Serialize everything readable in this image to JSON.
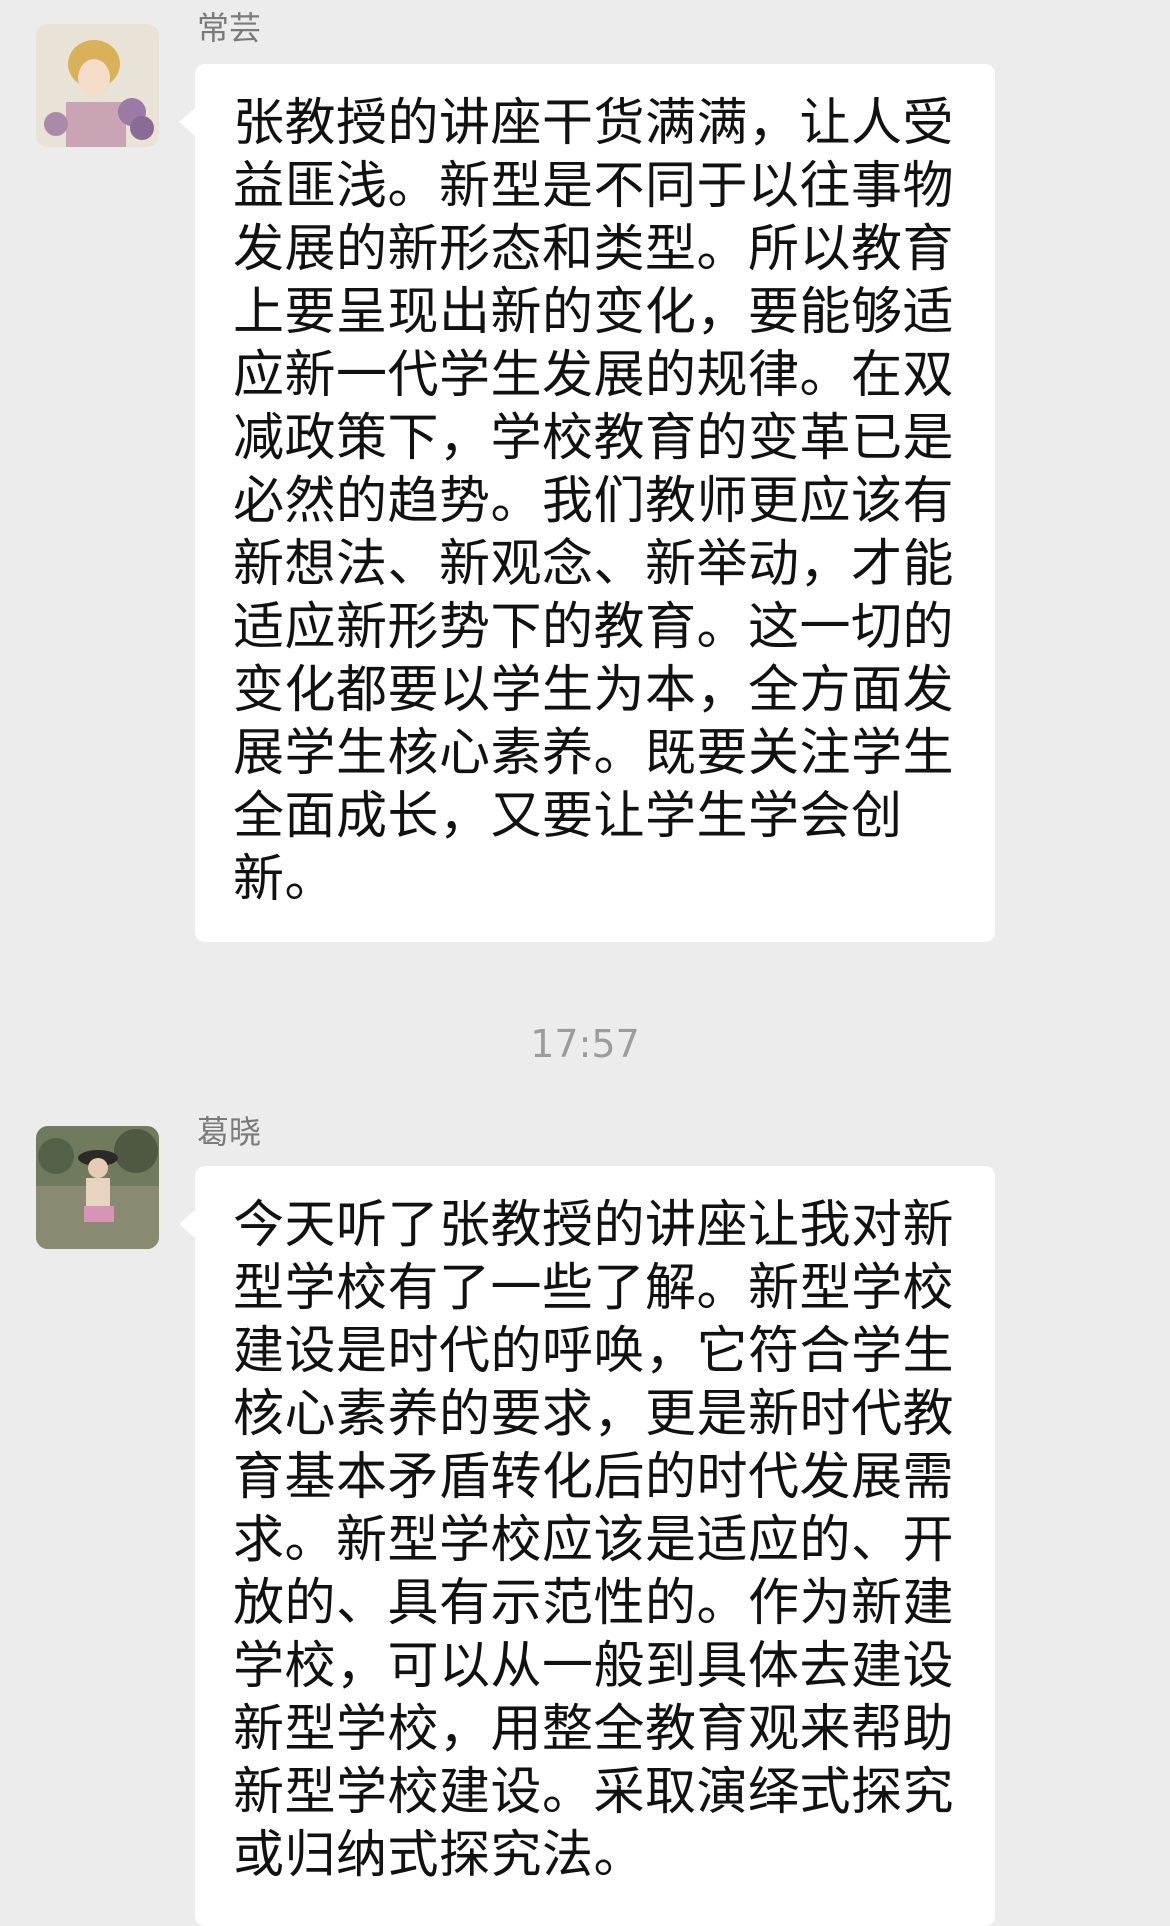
{
  "messages": [
    {
      "sender": "常芸",
      "avatar_icon": "illustrated-woman-avatar-icon",
      "text": "张教授的讲座干货满满，让人受\n益匪浅。新型是不同于以往事物\n发展的新形态和类型。所以教育\n上要呈现出新的变化，要能够适\n应新一代学生发展的规律。在双\n减政策下，学校教育的变革已是\n必然的趋势。我们教师更应该有\n新想法、新观念、新举动，才能\n适应新形势下的教育。这一切的\n变化都要以学生为本，全方面发\n展学生核心素养。既要关注学生\n全面成长，又要让学生学会创\n新。"
    },
    {
      "sender": "葛晓",
      "avatar_icon": "child-photo-avatar-icon",
      "text": "今天听了张教授的讲座让我对新\n型学校有了一些了解。新型学校\n建设是时代的呼唤，它符合学生\n核心素养的要求，更是新时代教\n育基本矛盾转化后的时代发展需\n求。新型学校应该是适应的、开\n放的、具有示范性的。作为新建\n学校，可以从一般到具体去建设\n新型学校，用整全教育观来帮助\n新型学校建设。采取演绎式探究\n或归纳式探究法。"
    }
  ],
  "timestamp": "17:57",
  "colors": {
    "background": "#ececec",
    "bubble": "#ffffff",
    "sender_name": "#7a7a7a",
    "timestamp": "#9c9c9c"
  }
}
